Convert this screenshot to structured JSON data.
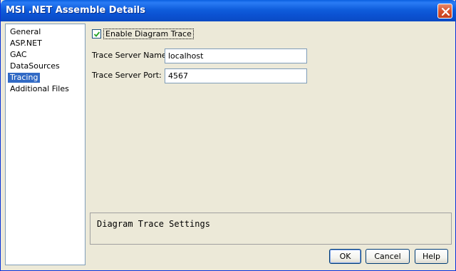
{
  "window": {
    "title": "MSI .NET Assemble Details"
  },
  "sidebar": {
    "items": [
      {
        "label": "General"
      },
      {
        "label": "ASP.NET"
      },
      {
        "label": "GAC"
      },
      {
        "label": "DataSources"
      },
      {
        "label": "Tracing",
        "selected": true
      },
      {
        "label": "Additional Files"
      }
    ]
  },
  "tracing": {
    "enable_label": "Enable Diagram Trace",
    "enable_checked": true,
    "server_name_label": "Trace Server Name:",
    "server_name_value": "localhost",
    "server_port_label": "Trace Server Port:",
    "server_port_value": "4567"
  },
  "description": {
    "text": "Diagram Trace Settings"
  },
  "buttons": {
    "ok": "OK",
    "cancel": "Cancel",
    "help": "Help"
  },
  "colors": {
    "title_bar": "#0a52d2",
    "selection": "#316ac5",
    "close_button": "#d8512c",
    "dialog_background": "#ece9d8"
  }
}
